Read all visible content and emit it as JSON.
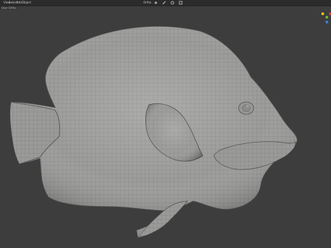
{
  "header": {
    "menus": [
      "View",
      "Select",
      "Add",
      "Object"
    ],
    "view_mode": "Ortho",
    "breadcrumb": "User Ortho"
  },
  "gizmo": {
    "x_color": "#d8433f",
    "y_color": "#80b52f",
    "z_color": "#3a82d7",
    "neutral_color": "#f0c419"
  },
  "viewport": {
    "background": "#3d3d3d",
    "object": "fish-mesh",
    "mesh_color": "#9a9a98",
    "wire_color": "#6c6c6a"
  }
}
